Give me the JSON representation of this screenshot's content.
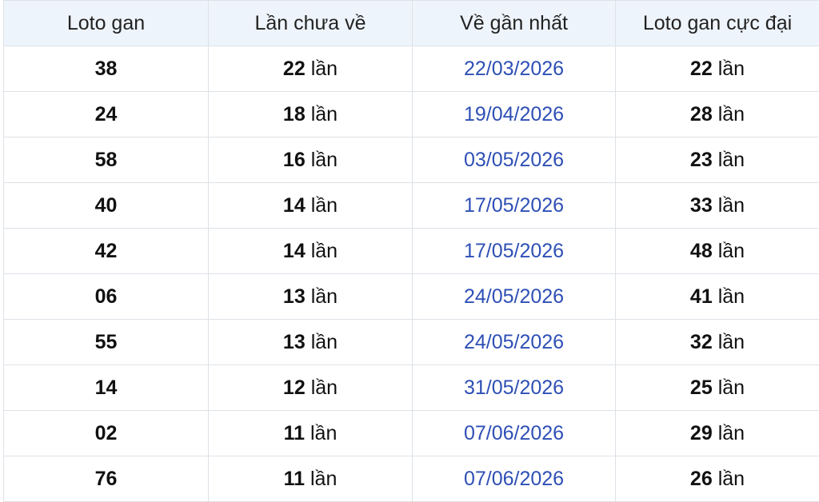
{
  "table": {
    "headers": [
      "Loto gan",
      "Lần chưa về",
      "Về gần nhất",
      "Loto gan cực đại"
    ],
    "unit": "lần",
    "rows": [
      {
        "loto": "38",
        "missing": "22",
        "last_date": "22/03/2026",
        "max_gap": "22"
      },
      {
        "loto": "24",
        "missing": "18",
        "last_date": "19/04/2026",
        "max_gap": "28"
      },
      {
        "loto": "58",
        "missing": "16",
        "last_date": "03/05/2026",
        "max_gap": "23"
      },
      {
        "loto": "40",
        "missing": "14",
        "last_date": "17/05/2026",
        "max_gap": "33"
      },
      {
        "loto": "42",
        "missing": "14",
        "last_date": "17/05/2026",
        "max_gap": "48"
      },
      {
        "loto": "06",
        "missing": "13",
        "last_date": "24/05/2026",
        "max_gap": "41"
      },
      {
        "loto": "55",
        "missing": "13",
        "last_date": "24/05/2026",
        "max_gap": "32"
      },
      {
        "loto": "14",
        "missing": "12",
        "last_date": "31/05/2026",
        "max_gap": "25"
      },
      {
        "loto": "02",
        "missing": "11",
        "last_date": "07/06/2026",
        "max_gap": "29"
      },
      {
        "loto": "76",
        "missing": "11",
        "last_date": "07/06/2026",
        "max_gap": "26"
      }
    ]
  },
  "colors": {
    "header_bg": "#eef4fb",
    "border": "#dde2e8",
    "date_text": "#2e4fb5"
  }
}
